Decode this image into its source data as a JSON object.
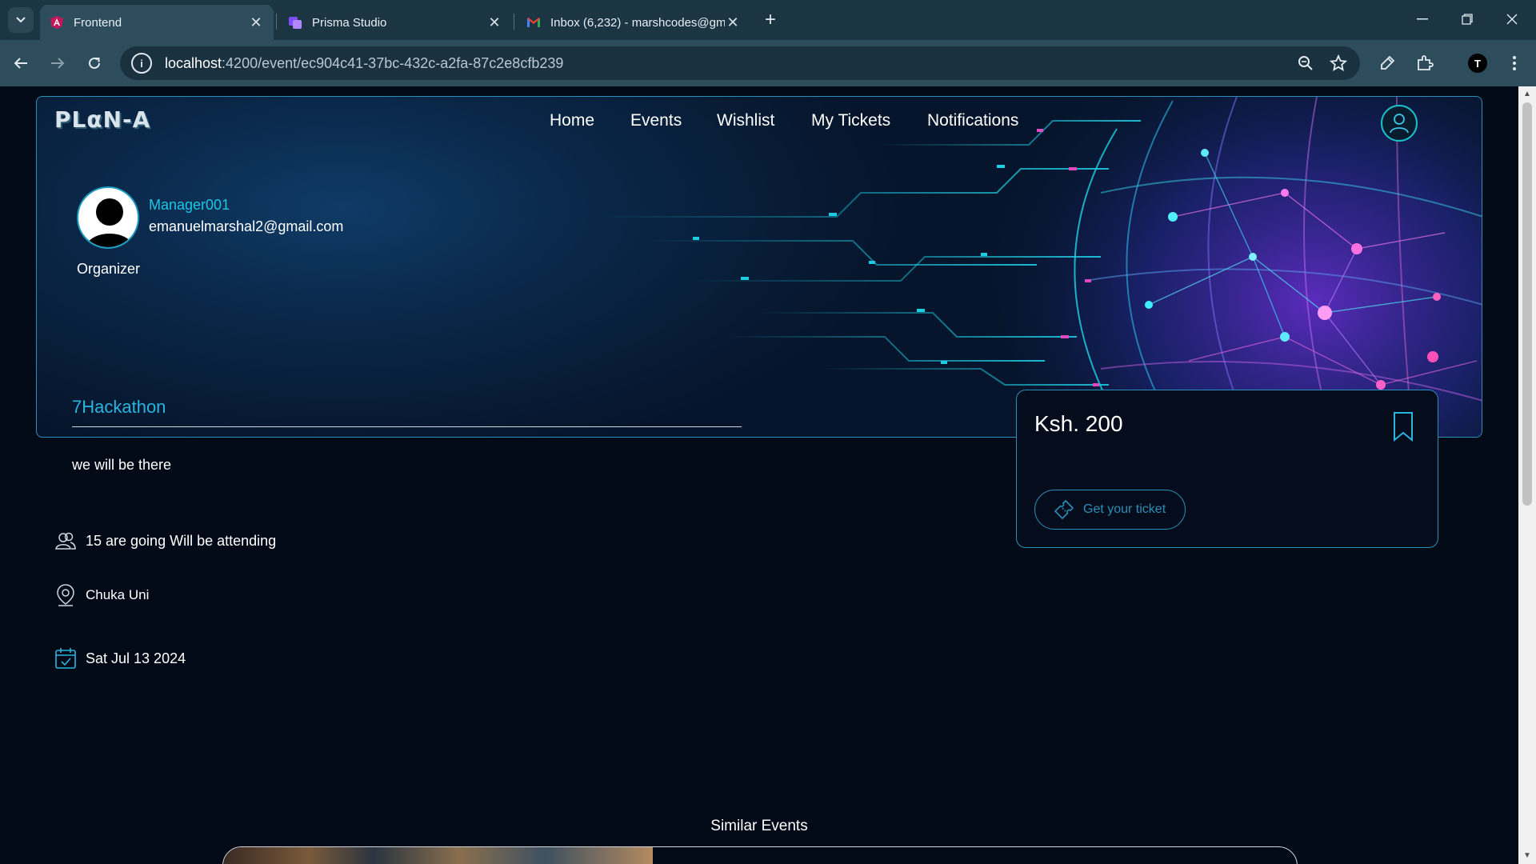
{
  "browser": {
    "tabs": [
      {
        "title": "Frontend",
        "active": true,
        "icon": "angular-icon"
      },
      {
        "title": "Prisma Studio",
        "active": false,
        "icon": "prisma-icon"
      },
      {
        "title": "Inbox (6,232) - marshcodes@gm",
        "active": false,
        "icon": "gmail-icon"
      }
    ],
    "url_host": "localhost",
    "url_rest": ":4200/event/ec904c41-37bc-432c-a2fa-87c2e8cfb239",
    "profile_initial": "T"
  },
  "site": {
    "logo": "PLαN-A",
    "nav": [
      "Home",
      "Events",
      "Wishlist",
      "My Tickets",
      "Notifications"
    ]
  },
  "organizer": {
    "name": "Manager001",
    "email": "emanuelmarshal2@gmail.com",
    "role": "Organizer"
  },
  "event": {
    "title": "7Hackathon",
    "description": "we will be there",
    "attendance": "15 are going Will be attending",
    "location": "Chuka Uni",
    "date": "Sat Jul 13 2024"
  },
  "ticket": {
    "price": "Ksh. 200",
    "button_label": "Get your ticket"
  },
  "similar_heading": "Similar Events",
  "colors": {
    "accent": "#2bb4e0",
    "border": "#2b8fb7",
    "background": "#030a17"
  }
}
